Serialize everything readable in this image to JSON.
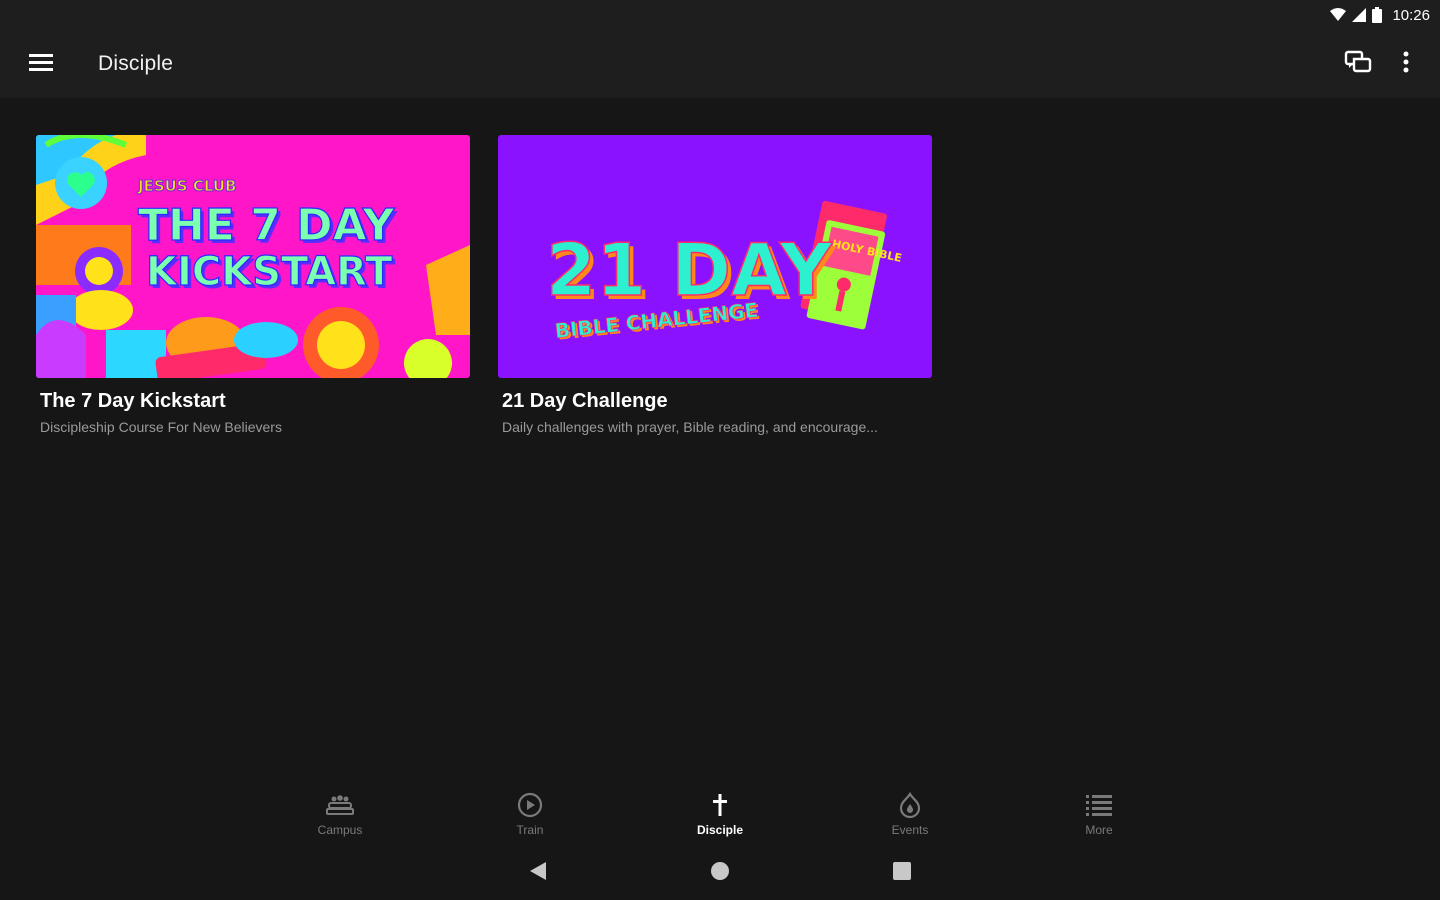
{
  "status_bar": {
    "time": "10:26"
  },
  "app_bar": {
    "title": "Disciple"
  },
  "cards": [
    {
      "title": "The 7 Day Kickstart",
      "subtitle": "Discipleship Course For New Believers",
      "art": {
        "top_text": "JESUS CLUB",
        "line1": "THE 7 DAY",
        "line2": "KICKSTART",
        "bg": "#ff16c8"
      }
    },
    {
      "title": "21 Day Challenge",
      "subtitle": "Daily challenges with prayer, Bible reading, and encourage...",
      "art": {
        "line1": "21 DAY",
        "line2": "BIBLE CHALLENGE",
        "book_text": "HOLY BIBLE",
        "bg": "#8a12ff"
      }
    }
  ],
  "bottom_nav": {
    "items": [
      {
        "label": "Campus",
        "icon": "campus-icon"
      },
      {
        "label": "Train",
        "icon": "play-circle-icon"
      },
      {
        "label": "Disciple",
        "icon": "cross-icon",
        "active": true
      },
      {
        "label": "Events",
        "icon": "flame-icon"
      },
      {
        "label": "More",
        "icon": "list-icon"
      }
    ]
  },
  "colors": {
    "background": "#161616",
    "app_bar": "#1e1e1e",
    "active": "#ffffff",
    "inactive": "#7a7a7a"
  }
}
